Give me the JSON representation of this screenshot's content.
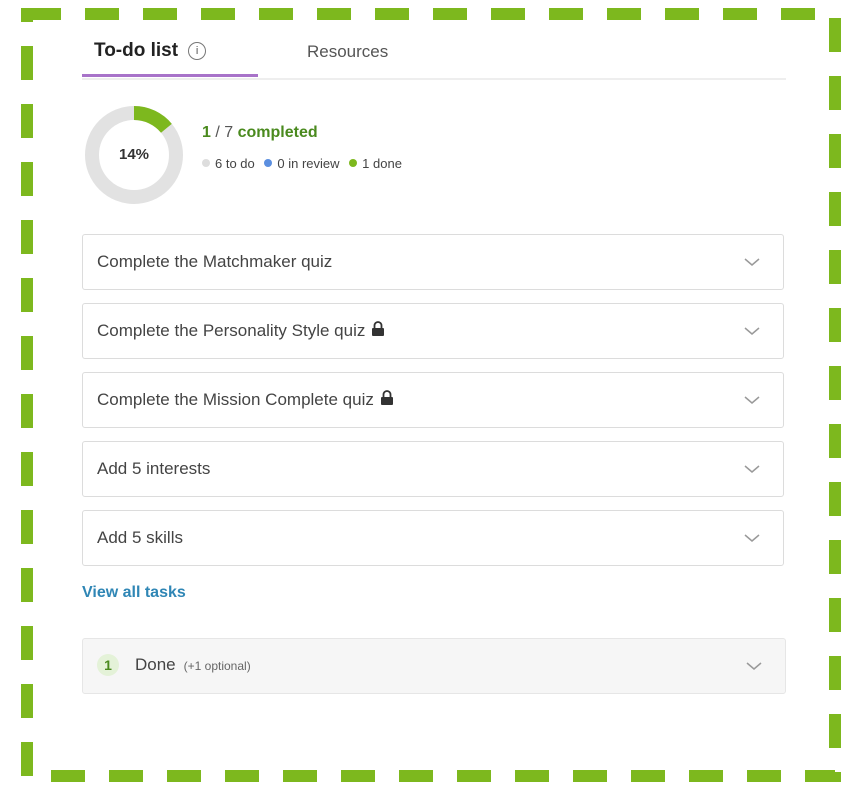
{
  "tabs": {
    "todo": "To-do list",
    "resources": "Resources"
  },
  "progress": {
    "percent_label": "14%",
    "fraction": 0.14,
    "completed": "1",
    "total": "/ 7",
    "completed_word": "completed",
    "stats": {
      "todo": "6 to do",
      "review": "0 in review",
      "done": "1 done"
    }
  },
  "tasks": [
    {
      "label": "Complete the Matchmaker quiz",
      "locked": false
    },
    {
      "label": "Complete the Personality Style quiz",
      "locked": true
    },
    {
      "label": "Complete the Mission Complete quiz",
      "locked": true
    },
    {
      "label": "Add 5 interests",
      "locked": false
    },
    {
      "label": "Add 5 skills",
      "locked": false
    }
  ],
  "view_all": "View all tasks",
  "done_section": {
    "count": "1",
    "label": "Done",
    "optional": "(+1 optional)"
  },
  "colors": {
    "frame_green": "#7db81e",
    "accent_purple": "#a873c9",
    "done_green": "#7db81e",
    "review_blue": "#5b8fe0",
    "todo_grey": "#dddddd",
    "link_blue": "#2f86b5"
  }
}
